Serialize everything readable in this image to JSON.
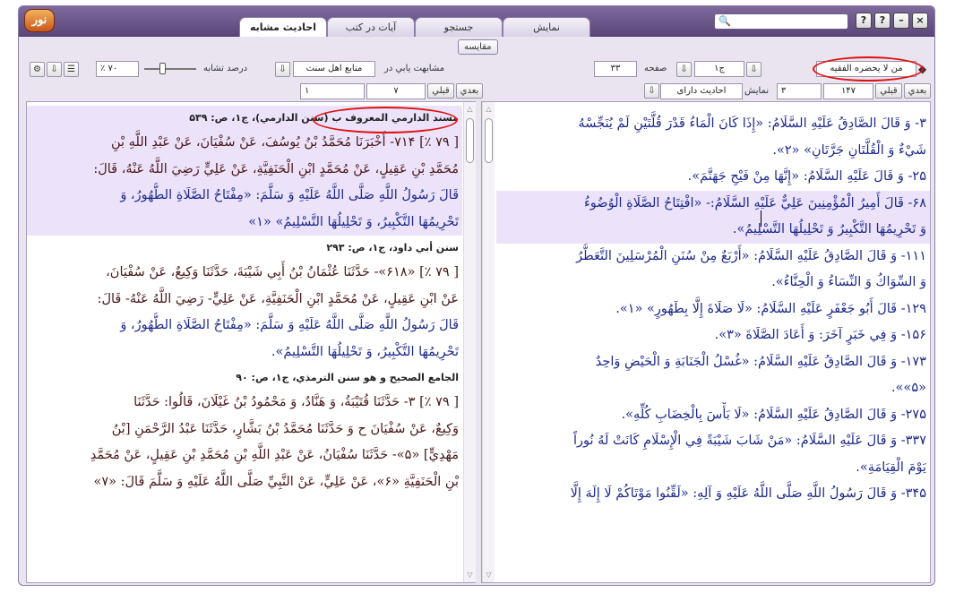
{
  "app": {
    "logo_text": "نور",
    "tabs": [
      "نمایش",
      "جستجو",
      "آیات در کتب",
      "احادیث مشابه"
    ],
    "active_tab": "احادیث مشابه",
    "compare_label": "مقایسه",
    "window_buttons": [
      "?",
      "?",
      "–",
      "×"
    ]
  },
  "left_toolbar": {
    "similarity_label": "درصد تشابه",
    "similarity_value": "٪ ۷۰",
    "similar_in_label": "مشابهت يابي در",
    "source_select": "منابع اهل سنت",
    "nav_next": "بعدي",
    "nav_prev": "قبلي",
    "num1": "۷",
    "num2": "۱"
  },
  "right_toolbar": {
    "book_select": "من لا يحضره الفقيه",
    "volume_label": "ج۱",
    "page_label": "صفحه",
    "page_value": "۳۳",
    "nav_next": "بعدي",
    "nav_prev": "قبلي",
    "count_value": "۱۴۷",
    "count2_value": "۳",
    "display_label": "نمايش",
    "display_select": "احاديث داراى"
  },
  "left_pane": {
    "blocks": [
      {
        "header": "مسند الدارمي المعروف ب (سنن الدارمي)، ج۱، ص: ۵۳۹",
        "highlighted": true,
        "lines": [
          "[ ۷۹ ٪] ۷۱۴- أَخْبَرَنَا مُحَمَّدُ بْنُ يُوسُفَ، عَنْ سُفْيَانَ، عَنْ عَبْدِ اللَّهِ بْنِ",
          "مُحَمَّدِ بْنِ عَقِيلٍ، عَنْ مُحَمَّدٍ ابْنِ الْحَنَفِيَّةِ، عَنْ عَلِيٍّ رَضِيَ اللَّهُ عَنْهُ، قَالَ:",
          "قَالَ رَسُولُ اللَّهِ صَلَّى اللَّهُ عَلَيْهِ وَ سَلَّمَ: «مِفْتَاحُ الصَّلَاةِ الطُّهُورُ، وَ",
          "تَحْرِيمُهَا التَّكْبِيرُ، وَ تَحْلِيلُهَا التَّسْلِيمُ» «۱»"
        ]
      },
      {
        "header": "سنن أبي داود، ج۱، ص: ۲۹۳",
        "highlighted": false,
        "lines": [
          "[ ۷۹ ٪] «۶۱۸»- حَدَّثَنَا عُثْمَانُ بْنُ أَبِي شَيْبَةَ، حَدَّثَنَا وَكِيعٌ، عَنْ سُفْيَانَ،",
          "عَنْ ابْنِ عَقِيلٍ، عَنْ مُحَمَّدٍ ابْنِ الْحَنَفِيَّةِ، عَنْ عَلِيٍّ- رَضِيَ اللَّهُ عَنْهُ- قَالَ:",
          "قَالَ رَسُولُ اللَّهِ صَلَّى اللَّهُ عَلَيْهِ وَ سَلَّمَ: «مِفْتَاحُ الصَّلَاةِ الطُّهُورُ، وَ",
          "تَحْرِيمُهَا التَّكْبِيرُ، وَ تَحْلِيلُهَا التَّسْلِيمُ»."
        ]
      },
      {
        "header": "الجامع الصحيح و هو سنن الترمذي، ج۱، ص: ۹۰",
        "highlighted": false,
        "lines": [
          "[ ۷۹ ٪] ۳- حَدَّثَنَا قُتَيْبَةُ، وَ هَنَّادٌ، وَ مَحْمُودُ بْنُ غَيْلَانَ، قَالُوا: حَدَّثَنَا",
          "وَكِيعٌ، عَنْ سُفْيَانَ ح وَ حَدَّثَنَا مُحَمَّدُ بْنُ بَشَّارٍ، حَدَّثَنَا عَبْدُ الرَّحْمَنِ [بْنُ",
          "مَهْدِيٍّ] «۵»- حَدَّثَنَا سُفْيَانُ، عَنْ عَبْدِ اللَّهِ بْنِ مُحَمَّدِ بْنِ عَقِيلٍ، عَنْ مُحَمَّدِ",
          "بْنِ الْحَنَفِيَّةِ «۶»، عَنْ عَلِيٍّ، عَنْ النَّبِيِّ صَلَّى اللَّهُ عَلَيْهِ وَ سَلَّمَ قَالَ: «۷»"
        ]
      }
    ]
  },
  "right_pane": {
    "lines": [
      {
        "t": "۳- وَ قَالَ الصَّادِقُ عَلَيْهِ السَّلَامُ: «إِذَا كَانَ الْمَاءُ قَدْرَ قُلَّتَيْنِ لَمْ يُنَجِّسْهُ",
        "hl": false
      },
      {
        "t": "شَيْ‌ءٌ وَ الْقُلَّتَانِ جَرَّتَانِ» «۲».",
        "hl": false
      },
      {
        "t": "۲۵- وَ قَالَ عَلَيْهِ السَّلَامُ: «إِنَّهَا مِنْ فَيْحِ جَهَنَّمَ».",
        "hl": false
      },
      {
        "t": "۶۸- قَالَ أَمِيرُ الْمُؤْمِنِينَ عَلِيٌّ عَلَيْهِ السَّلَامُ:- «افْتِتَاحُ الصَّلَاةِ الْوُضُوءُ",
        "hl": true
      },
      {
        "t": "وَ تَحْرِيمُهَا التَّكْبِيرُ وَ تَحْلِيلُهَا التَّسْلِيمُ».",
        "hl": true
      },
      {
        "t": "۱۱۱- وَ قَالَ الصَّادِقُ عَلَيْهِ السَّلَامُ: «أَرْبَعٌ مِنْ سُنَنِ الْمُرْسَلِينَ التَّعَطُّرُ",
        "hl": false
      },
      {
        "t": "وَ السِّوَاكُ وَ النِّسَاءُ وَ الْحِنَّاءُ».",
        "hl": false
      },
      {
        "t": "۱۲۹- قَالَ أَبُو جَعْفَرٍ عَلَيْهِ السَّلَامُ: «لَا صَلَاةَ إِلَّا بِطَهُورٍ» «۱».",
        "hl": false
      },
      {
        "t": "۱۵۶- وَ فِي خَبَرٍ آخَرَ: وَ أَعَادَ الصَّلَاةَ «۳».",
        "hl": false
      },
      {
        "t": "۱۷۳- وَ قَالَ الصَّادِقُ عَلَيْهِ السَّلَامُ: «غُسْلُ الْجَنَابَةِ وَ الْحَيْضِ وَاحِدٌ",
        "hl": false
      },
      {
        "t": "«۵»».",
        "hl": false
      },
      {
        "t": "۲۷۵- وَ قَالَ الصَّادِقُ عَلَيْهِ السَّلَامُ: «لَا بَأْسَ بِالْخِضَابِ كُلِّهِ».",
        "hl": false
      },
      {
        "t": "۳۳۷- وَ قَالَ عَلَيْهِ السَّلَامُ: «مَنْ شَابَ شَيْبَةً فِي الْإِسْلَامِ كَانَتْ لَهُ نُوراً",
        "hl": false
      },
      {
        "t": "يَوْمَ الْقِيَامَةِ».",
        "hl": false
      },
      {
        "t": "۳۴۵- وَ قَالَ رَسُولُ اللَّهِ صَلَّى اللَّهُ عَلَيْهِ وَ آلِهِ: «لَقِّنُوا مَوْتَاكُمْ لَا إِلَهَ إِلَّا",
        "hl": false
      }
    ]
  }
}
